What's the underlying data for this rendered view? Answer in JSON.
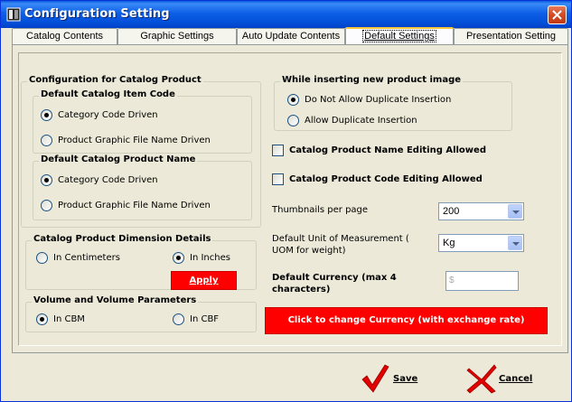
{
  "window": {
    "title": "Configuration Setting"
  },
  "tabs": [
    {
      "label": "Catalog Contents"
    },
    {
      "label": "Graphic Settings"
    },
    {
      "label": "Auto Update Contents"
    },
    {
      "label": "Default Settings",
      "active": true
    },
    {
      "label": "Presentation Setting"
    }
  ],
  "catalog_product": {
    "title": "Configuration for Catalog Product",
    "item_code": {
      "title": "Default  Catalog Item Code",
      "options": [
        "Category Code Driven",
        "Product Graphic File Name Driven"
      ],
      "selected": 0
    },
    "product_name": {
      "title": "Default  Catalog Product Name",
      "options": [
        "Category Code Driven",
        "Product Graphic File Name Driven"
      ],
      "selected": 0
    }
  },
  "dimension": {
    "title": "Catalog Product Dimension Details",
    "options": [
      "In Centimeters",
      "In Inches"
    ],
    "selected": 1,
    "apply_label": "Apply"
  },
  "volume": {
    "title": "Volume and Volume Parameters",
    "options": [
      "In CBM",
      "In CBF"
    ],
    "selected": 0
  },
  "image_insert": {
    "title": "While inserting new product  image",
    "options": [
      "Do Not Allow Duplicate Insertion",
      "Allow Duplicate Insertion"
    ],
    "selected": 0
  },
  "checks": {
    "name_editing": "Catalog Product Name Editing Allowed",
    "code_editing": "Catalog Product Code Editing Allowed"
  },
  "thumbnails": {
    "label": "Thumbnails per page",
    "value": "200"
  },
  "uom": {
    "label_line1": "Default Unit of Measurement (",
    "label_line2": "UOM for weight)",
    "value": "Kg"
  },
  "currency": {
    "label_line1": "Default Currency (max 4",
    "label_line2": "characters)",
    "value": "$",
    "change_label": "Click to change Currency (with exchange rate)"
  },
  "footer": {
    "save_label": "Save",
    "cancel_label": "Cancel"
  },
  "colors": {
    "accent_red": "#ff0000",
    "title_blue": "#0350d8"
  }
}
